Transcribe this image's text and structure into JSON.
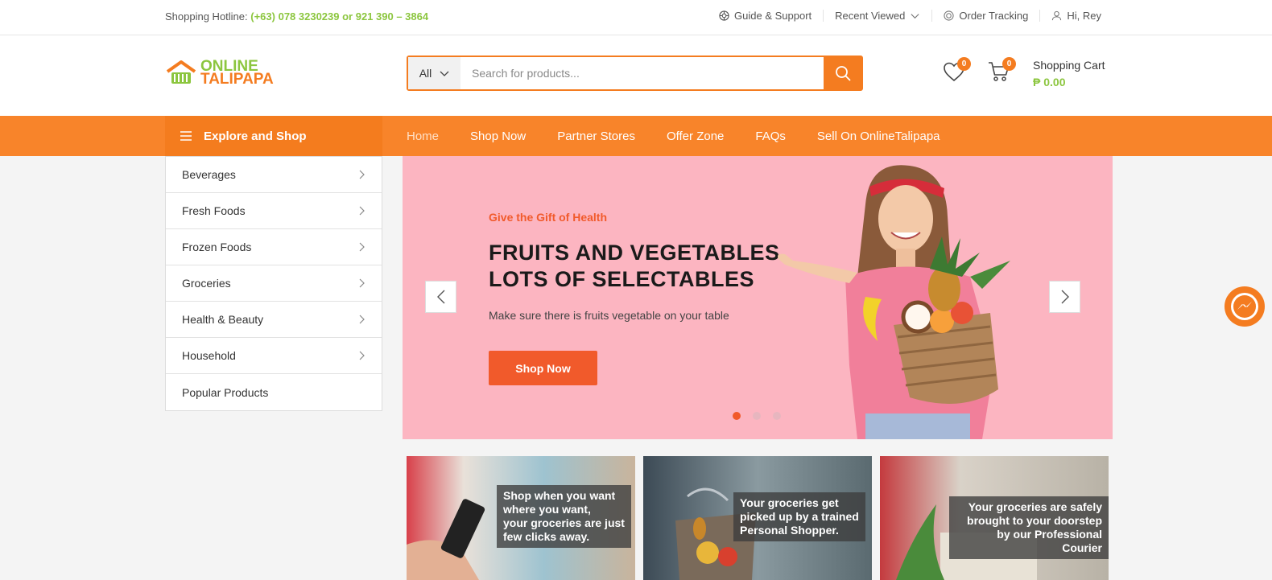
{
  "topbar": {
    "hotline_label": "Shopping Hotline:",
    "hotline_number": "(+63) 078 3230239 or 921 390 – 3864",
    "links": [
      "Guide & Support",
      "Recent Viewed",
      "Order Tracking",
      "Hi, Rey"
    ]
  },
  "header": {
    "logo_line1": "ONLINE",
    "logo_line2": "TALIPAPA",
    "search": {
      "category": "All",
      "placeholder": "Search for products..."
    },
    "wishlist_count": "0",
    "cart_count": "0",
    "cart_label": "Shopping Cart",
    "cart_amount": "₱ 0.00"
  },
  "nav": {
    "explore_label": "Explore and Shop",
    "links": [
      "Home",
      "Shop Now",
      "Partner Stores",
      "Offer Zone",
      "FAQs",
      "Sell On OnlineTalipapa"
    ]
  },
  "sidebar": {
    "items": [
      {
        "label": "Beverages"
      },
      {
        "label": "Fresh Foods"
      },
      {
        "label": "Frozen Foods"
      },
      {
        "label": "Groceries"
      },
      {
        "label": "Health & Beauty"
      },
      {
        "label": "Household"
      },
      {
        "label": "Popular Products"
      }
    ]
  },
  "hero": {
    "kicker": "Give the Gift of Health",
    "title_line1": "FRUITS AND VEGETABLES",
    "title_line2": "LOTS OF SELECTABLES",
    "subtitle": "Make sure there is fruits vegetable on your table",
    "button": "Shop Now",
    "active_slide": 1,
    "slide_count": 3
  },
  "cards": [
    {
      "caption_lines": [
        "Shop when you want",
        "where you want,",
        "your groceries are just",
        "few clicks away."
      ]
    },
    {
      "caption_lines": [
        "Your groceries get",
        "picked up by a trained",
        "Personal Shopper."
      ]
    },
    {
      "caption_lines": [
        "Your groceries are safely",
        "brought to your doorstep",
        "by our Professional Courier"
      ]
    }
  ],
  "colors": {
    "accent": "#f47c20",
    "green": "#8cc63f",
    "hero_bg": "#fcb5c1",
    "cta": "#f15a2b"
  }
}
